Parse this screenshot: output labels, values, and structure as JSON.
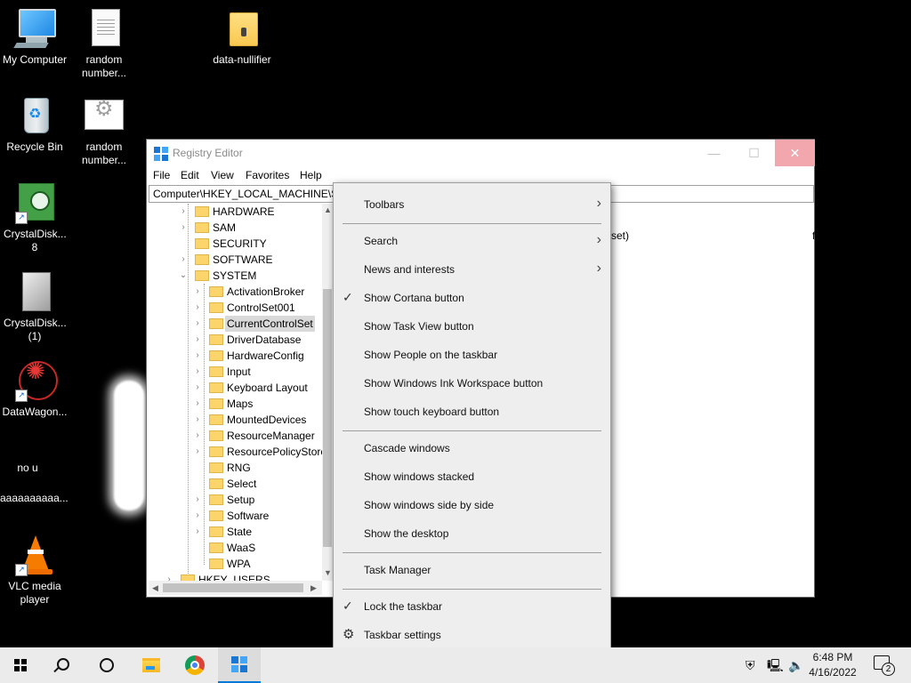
{
  "desktop": {
    "icons": [
      {
        "label": "My Computer",
        "icon": "computer-icon"
      },
      {
        "label": "random number...",
        "icon": "text-document-icon"
      },
      {
        "label": "data-nullifier",
        "icon": "folder-icon"
      },
      {
        "label": "Recycle Bin",
        "icon": "recycle-bin-icon"
      },
      {
        "label": "random number...",
        "icon": "settings-file-icon"
      },
      {
        "label": "CrystalDisk... 8",
        "icon": "crystaldisk-icon"
      },
      {
        "label": "CrystalDisk... (1)",
        "icon": "installer-icon"
      },
      {
        "label": "DataWagon...",
        "icon": "mandala-icon"
      },
      {
        "label": "no u",
        "icon": ""
      },
      {
        "label": "aaaaaaaaaa...",
        "icon": ""
      },
      {
        "label": "VLC media player",
        "icon": "vlc-icon"
      }
    ]
  },
  "regedit": {
    "title": "Registry Editor",
    "menu": [
      "File",
      "Edit",
      "View",
      "Favorites",
      "Help"
    ],
    "address": "Computer\\HKEY_LOCAL_MACHINE\\SYSTEM\\CurrentControlSet",
    "tree": {
      "top_level": [
        "HARDWARE",
        "SAM",
        "SECURITY",
        "SOFTWARE",
        "SYSTEM"
      ],
      "system_children": [
        "ActivationBroker",
        "ControlSet001",
        "CurrentControlSet",
        "DriverDatabase",
        "HardwareConfig",
        "Input",
        "Keyboard Layout",
        "Maps",
        "MountedDevices",
        "ResourceManager",
        "ResourcePolicyStore",
        "RNG",
        "Select",
        "Setup",
        "Software",
        "State",
        "WaaS",
        "WPA"
      ],
      "selected": "CurrentControlSet",
      "next_hive": "HKEY_USERS"
    },
    "right_pane_fragment": "set)",
    "right_pane_fragment_2": "fi..."
  },
  "context_menu": {
    "items": [
      {
        "label": "Toolbars",
        "submenu": true,
        "checked": false
      },
      {
        "label": "Search",
        "submenu": true,
        "checked": false
      },
      {
        "label": "News and interests",
        "submenu": true,
        "checked": false
      },
      {
        "label": "Show Cortana button",
        "submenu": false,
        "checked": true
      },
      {
        "label": "Show Task View button",
        "submenu": false,
        "checked": false
      },
      {
        "label": "Show People on the taskbar",
        "submenu": false,
        "checked": false
      },
      {
        "label": "Show Windows Ink Workspace button",
        "submenu": false,
        "checked": false
      },
      {
        "label": "Show touch keyboard button",
        "submenu": false,
        "checked": false
      },
      {
        "label": "Cascade windows",
        "submenu": false,
        "checked": false
      },
      {
        "label": "Show windows stacked",
        "submenu": false,
        "checked": false
      },
      {
        "label": "Show windows side by side",
        "submenu": false,
        "checked": false
      },
      {
        "label": "Show the desktop",
        "submenu": false,
        "checked": false
      },
      {
        "label": "Task Manager",
        "submenu": false,
        "checked": false
      },
      {
        "label": "Lock the taskbar",
        "submenu": false,
        "checked": true
      },
      {
        "label": "Taskbar settings",
        "submenu": false,
        "checked": false,
        "icon": "gear-icon"
      }
    ]
  },
  "taskbar": {
    "buttons": [
      "start-icon",
      "search-icon",
      "task-view-icon",
      "file-explorer-icon",
      "chrome-icon",
      "registry-editor-icon"
    ],
    "active": "registry-editor-icon",
    "tray_icons": [
      "security-shield-icon",
      "network-icon",
      "volume-icon"
    ],
    "time": "6:48 PM",
    "date": "4/16/2022",
    "notification_count": "2"
  },
  "colors": {
    "desktop_background": "#000000",
    "taskbar": "#ebebeb",
    "context_menu": "#eeeeee",
    "close_button": "#f1a7ad",
    "accent": "#0078d7"
  }
}
